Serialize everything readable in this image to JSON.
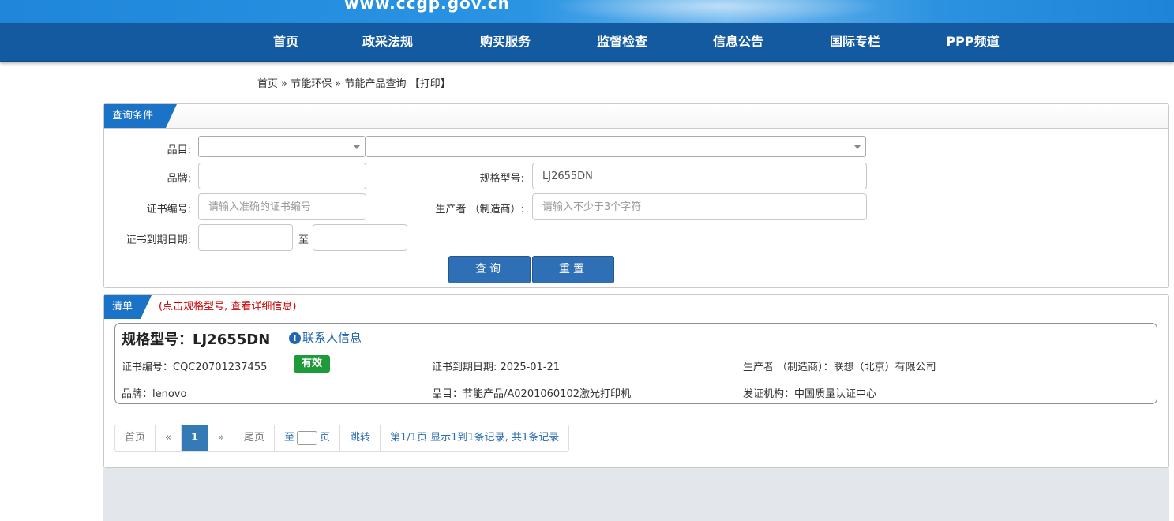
{
  "banner": {
    "url": "www.ccgp.gov.cn"
  },
  "nav": [
    {
      "label": "首页"
    },
    {
      "label": "政采法规"
    },
    {
      "label": "购买服务"
    },
    {
      "label": "监督检查"
    },
    {
      "label": "信息公告"
    },
    {
      "label": "国际专栏"
    },
    {
      "label": "PPP频道"
    }
  ],
  "breadcrumb": {
    "home": "首页",
    "sep1": "»",
    "section": "节能环保",
    "sep2": "»",
    "current": "节能产品查询",
    "print": "【打印】"
  },
  "query": {
    "title": "查询条件",
    "category_label": "品目:",
    "brand_label": "品牌:",
    "brand_value": "",
    "model_label": "规格型号:",
    "model_value": "LJ2655DN",
    "cert_label": "证书编号:",
    "cert_placeholder": "请输入准确的证书编号",
    "maker_label": "生产者 （制造商）:",
    "maker_placeholder": "请输入不少于3个字符",
    "expiry_label": "证书到期日期:",
    "expiry_to": "至",
    "search_button": "查询",
    "reset_button": "重置"
  },
  "results": {
    "title": "清单",
    "hint": "(点击规格型号, 查看详细信息)",
    "items": [
      {
        "model": "规格型号：LJ2655DN",
        "contact": "联系人信息",
        "cert_no": "证书编号：CQC20701237455",
        "status": "有效",
        "expiry": "证书到期日期: 2025-01-21",
        "maker": "生产者 （制造商）：联想（北京）有限公司",
        "brand": "品牌：lenovo",
        "category": "品目：节能产品/A0201060102激光打印机",
        "issuer": "发证机构：中国质量认证中心"
      }
    ]
  },
  "pager": {
    "first": "首页",
    "prev": "«",
    "current": "1",
    "next": "»",
    "last": "尾页",
    "goto_prefix": "至",
    "goto_suffix": "页",
    "jump": "跳转",
    "info": "第1/1页  显示1到1条记录, 共1条记录"
  }
}
